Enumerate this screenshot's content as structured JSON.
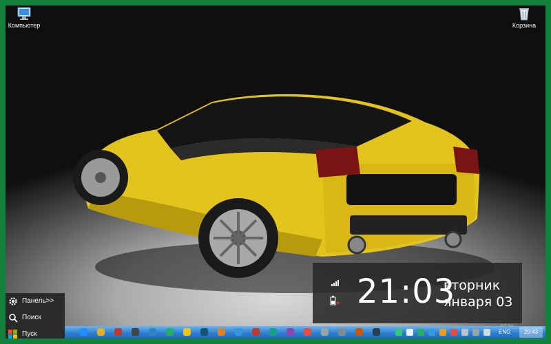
{
  "desktop": {
    "icons": [
      {
        "label": "Компьютер",
        "icon": "computer-icon"
      },
      {
        "label": "Корзина",
        "icon": "recycle-bin-icon"
      }
    ]
  },
  "clock": {
    "time": "21:03",
    "weekday": "вторник",
    "date": "января 03",
    "icons": [
      "signal-icon",
      "battery-icon"
    ]
  },
  "start_menu": {
    "items": [
      {
        "label": "Панель>>",
        "icon": "gear-icon"
      },
      {
        "label": "Поиск",
        "icon": "search-icon"
      },
      {
        "label": "Пуск",
        "icon": "windows-logo-icon"
      }
    ]
  },
  "taskbar": {
    "language": "ENG",
    "time": "20:43",
    "app_colors": [
      "#1e90ff",
      "#e8b020",
      "#c0392b",
      "#444444",
      "#2e86c1",
      "#27ae60",
      "#f1c40f",
      "#1a5276",
      "#e67e22",
      "#3498db",
      "#c0392b",
      "#16a085",
      "#8e44ad",
      "#e74c3c",
      "#95a5a6",
      "#7f8c8d",
      "#d35400",
      "#2c3e50"
    ]
  },
  "watermark": "0730"
}
